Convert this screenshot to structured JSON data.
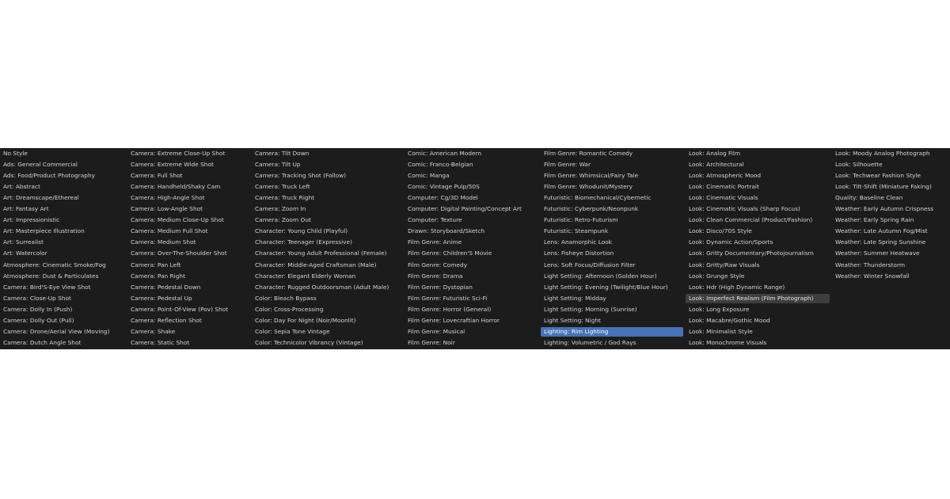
{
  "columns": [
    [
      {
        "label": "No Style"
      },
      {
        "label": "Ads: General Commercial"
      },
      {
        "label": "Ads: Food/Product Photography"
      },
      {
        "label": "Art: Abstract"
      },
      {
        "label": "Art: Dreamscape/Ethereal"
      },
      {
        "label": "Art: Fantasy Art"
      },
      {
        "label": "Art: Impressionistic"
      },
      {
        "label": "Art: Masterpiece Illustration"
      },
      {
        "label": "Art: Surrealist"
      },
      {
        "label": "Art: Watercolor"
      },
      {
        "label": "Atmosphere: Cinematic Smoke/Fog"
      },
      {
        "label": "Atmosphere: Dust & Particulates"
      },
      {
        "label": "Camera: Bird'S-Eye View Shot"
      },
      {
        "label": "Camera: Close-Up Shot"
      },
      {
        "label": "Camera: Dolly In (Push)"
      },
      {
        "label": "Camera: Dolly Out (Pull)"
      },
      {
        "label": "Camera: Drone/Aerial View (Moving)"
      },
      {
        "label": "Camera: Dutch Angle Shot"
      }
    ],
    [
      {
        "label": "Camera: Extreme Close-Up Shot"
      },
      {
        "label": "Camera: Extreme Wide Shot"
      },
      {
        "label": "Camera: Full Shot"
      },
      {
        "label": "Camera: Handheld/Shaky Cam"
      },
      {
        "label": "Camera: High-Angle Shot"
      },
      {
        "label": "Camera: Low-Angle Shot"
      },
      {
        "label": "Camera: Medium Close-Up Shot"
      },
      {
        "label": "Camera: Medium Full Shot"
      },
      {
        "label": "Camera: Medium Shot"
      },
      {
        "label": "Camera: Over-The-Shoulder Shot"
      },
      {
        "label": "Camera: Pan Left"
      },
      {
        "label": "Camera: Pan Right"
      },
      {
        "label": "Camera: Pedestal Down"
      },
      {
        "label": "Camera: Pedestal Up"
      },
      {
        "label": "Camera: Point-Of-View (Pov) Shot"
      },
      {
        "label": "Camera: Reflection Shot"
      },
      {
        "label": "Camera: Shake"
      },
      {
        "label": "Camera: Static Shot"
      }
    ],
    [
      {
        "label": "Camera: Tilt Down"
      },
      {
        "label": "Camera: Tilt Up"
      },
      {
        "label": "Camera: Tracking Shot (Follow)"
      },
      {
        "label": "Camera: Truck Left"
      },
      {
        "label": "Camera: Truck Right"
      },
      {
        "label": "Camera: Zoom In"
      },
      {
        "label": "Camera: Zoom Out"
      },
      {
        "label": "Character: Young Child (Playful)"
      },
      {
        "label": "Character: Teenager (Expressive)"
      },
      {
        "label": "Character: Young Adult Professional (Female)"
      },
      {
        "label": "Character: Middle-Aged Craftsman (Male)"
      },
      {
        "label": "Character: Elegant Elderly Woman"
      },
      {
        "label": "Character: Rugged Outdoorsman (Adult Male)"
      },
      {
        "label": "Color: Bleach Bypass"
      },
      {
        "label": "Color: Cross-Processing"
      },
      {
        "label": "Color: Day For Night (Noir/Moonlit)"
      },
      {
        "label": "Color: Sepia Tone Vintage"
      },
      {
        "label": "Color: Technicolor Vibrancy (Vintage)"
      }
    ],
    [
      {
        "label": "Comic: American Modern"
      },
      {
        "label": "Comic: Franco-Belgian"
      },
      {
        "label": "Comic: Manga"
      },
      {
        "label": "Comic: Vintage Pulp/50S"
      },
      {
        "label": "Computer: Cg/3D Model"
      },
      {
        "label": "Computer: Digital Painting/Concept Art"
      },
      {
        "label": "Computer: Texture"
      },
      {
        "label": "Drawn: Storyboard/Sketch"
      },
      {
        "label": "Film Genre: Anime"
      },
      {
        "label": "Film Genre: Children'S Movie"
      },
      {
        "label": "Film Genre: Comedy"
      },
      {
        "label": "Film Genre: Drama"
      },
      {
        "label": "Film Genre: Dystopian"
      },
      {
        "label": "Film Genre: Futuristic Sci-Fi"
      },
      {
        "label": "Film Genre: Horror (General)"
      },
      {
        "label": "Film Genre: Lovecraftian Horror"
      },
      {
        "label": "Film Genre: Musical"
      },
      {
        "label": "Film Genre: Noir"
      }
    ],
    [
      {
        "label": "Film Genre: Romantic Comedy"
      },
      {
        "label": "Film Genre: War"
      },
      {
        "label": "Film Genre: Whimsical/Fairy Tale"
      },
      {
        "label": "Film Genre: Whodunit/Mystery"
      },
      {
        "label": "Futuristic: Biomechanical/Cybernetic"
      },
      {
        "label": "Futuristic: Cyberpunk/Neonpunk"
      },
      {
        "label": "Futuristic: Retro-Futurism"
      },
      {
        "label": "Futuristic: Steampunk"
      },
      {
        "label": "Lens: Anamorphic Look"
      },
      {
        "label": "Lens: Fisheye Distortion"
      },
      {
        "label": "Lens: Soft Focus/Diffusion Filter"
      },
      {
        "label": "Light Setting: Afternoon (Golden Hour)"
      },
      {
        "label": "Light Setting: Evening (Twilight/Blue Hour)"
      },
      {
        "label": "Light Setting: Midday"
      },
      {
        "label": "Light Setting: Morning (Sunrise)"
      },
      {
        "label": "Light Setting: Night"
      },
      {
        "label": "Lighting: Rim Lighting",
        "state": "active"
      },
      {
        "label": "Lighting: Volumetric / God Rays"
      }
    ],
    [
      {
        "label": "Look: Analog Film"
      },
      {
        "label": "Look: Architectural"
      },
      {
        "label": "Look: Atmospheric Mood"
      },
      {
        "label": "Look: Cinematic Portrait"
      },
      {
        "label": "Look: Cinematic Visuals"
      },
      {
        "label": "Look: Cinematic Visuals (Sharp Focus)"
      },
      {
        "label": "Look: Clean Commercial (Product/Fashion)"
      },
      {
        "label": "Look: Disco/70S Style"
      },
      {
        "label": "Look: Dynamic Action/Sports"
      },
      {
        "label": "Look: Gritty Documentary/Photojournalism"
      },
      {
        "label": "Look: Gritty/Raw Visuals"
      },
      {
        "label": "Look: Grunge Style"
      },
      {
        "label": "Look: Hdr (High Dynamic Range)"
      },
      {
        "label": "Look: Imperfect Realism (Film Photograph)",
        "state": "hover"
      },
      {
        "label": "Look: Long Exposure"
      },
      {
        "label": "Look: Macabre/Gothic Mood"
      },
      {
        "label": "Look: Minimalist Style"
      },
      {
        "label": "Look: Monochrome Visuals"
      }
    ],
    [
      {
        "label": "Look: Moody Analog Photograph"
      },
      {
        "label": "Look: Silhouette"
      },
      {
        "label": "Look: Techwear Fashion Style"
      },
      {
        "label": "Look: Tilt-Shift (Miniature Faking)"
      },
      {
        "label": "Quality: Baseline Clean"
      },
      {
        "label": "Weather: Early Autumn Crispness"
      },
      {
        "label": "Weather: Early Spring Rain"
      },
      {
        "label": "Weather: Late Autumn Fog/Mist"
      },
      {
        "label": "Weather: Late Spring Sunshine"
      },
      {
        "label": "Weather: Summer Heatwave"
      },
      {
        "label": "Weather: Thunderstorm"
      },
      {
        "label": "Weather: Winter Snowfall"
      }
    ]
  ]
}
